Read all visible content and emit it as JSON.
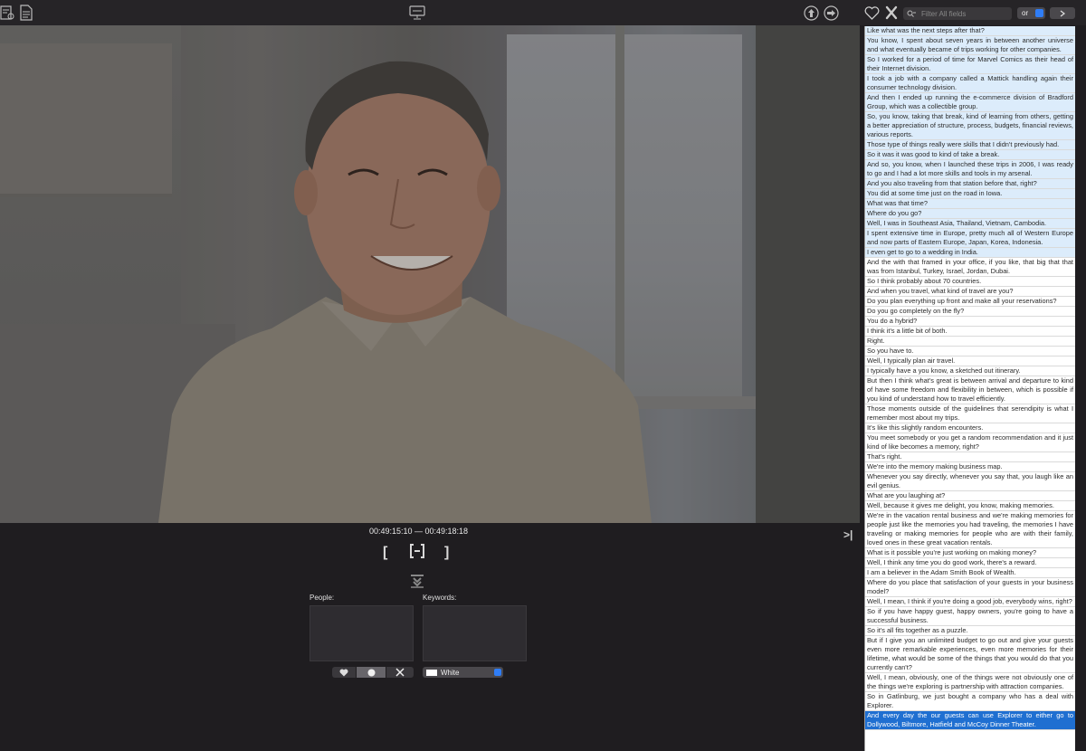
{
  "toolbar": {
    "filter_placeholder": "Filter All fields",
    "operator": "or"
  },
  "playback": {
    "timecode": "00:49:15:10 — 00:49:18:18",
    "mark_in": "[",
    "mark_out": "]"
  },
  "panels": {
    "people_label": "People:",
    "keywords_label": "Keywords:",
    "color_label": "White",
    "color_swatch": "#ffffff"
  },
  "transcript": {
    "highlighted_range": [
      0,
      15
    ],
    "selected_index": 47,
    "lines": [
      "Like what was the next steps after that?",
      "You know, I spent about seven years in between another universe and what eventually became of trips working for other companies.",
      "So I worked for a period of time for Marvel Comics as their head of their Internet division.",
      "I took a job with a company called a Mattick handling again their consumer technology division.",
      "And then I ended up running the e-commerce division of Bradford Group, which was a collectible group.",
      "So, you know, taking that break, kind of learning from others, getting a better appreciation of structure, process, budgets, financial reviews, various reports.",
      "Those type of things really were skills that I didn't previously had.",
      "So it was it was good to kind of take a break.",
      "And so, you know, when I launched these trips in 2006, I was ready to go and I had a lot more skills and tools in my arsenal.",
      "And you also traveling from that station before that, right?",
      "You did at some time just on the road in Iowa.",
      "What was that time?",
      "Where do you go?",
      "Well, I was in Southeast Asia, Thailand, Vietnam, Cambodia.",
      "I spent extensive time in Europe, pretty much all of Western Europe and now parts of Eastern Europe, Japan, Korea, Indonesia.",
      "I even get to go to a wedding in India.",
      "And the with that framed in your office, if you like, that big that that was from Istanbul, Turkey, Israel, Jordan, Dubai.",
      "So I think probably about 70 countries.",
      "And when you travel, what kind of travel are you?",
      "Do you plan everything up front and make all your reservations?",
      "Do you go completely on the fly?",
      "You do a hybrid?",
      "I think it's a little bit of both.",
      "Right.",
      "So you have to.",
      "Well, I typically plan air travel.",
      "I typically have a you know, a sketched out itinerary.",
      "But then I think what's great is between arrival and departure to kind of have some freedom and flexibility in between, which is possible if you kind of understand how to travel efficiently.",
      "Those moments outside of the guidelines that serendipity is what I remember most about my trips.",
      "It's like this slightly random encounters.",
      "You meet somebody or you get a random recommendation and it just kind of like becomes a memory, right?",
      "That's right.",
      "We're into the memory making business map.",
      "Whenever you say directly, whenever you say that, you laugh like an evil genius.",
      "What are you laughing at?",
      "Well, because it gives me delight, you know, making memories.",
      "We're in the vacation rental business and we're making memories for people just like the memories you had traveling, the memories I have traveling or making memories for people who are with their family, loved ones in these great vacation rentals.",
      "What is it possible you're just working on making money?",
      "Well, I think any time you do good work, there's a reward.",
      "I am a believer in the Adam Smith Book of Wealth.",
      "Where do you place that satisfaction of your guests in your business model?",
      "Well, I mean, I think if you're doing a good job, everybody wins, right?",
      "So if you have happy guest, happy owners, you're going to have a successful business.",
      "So it's all fits together as a puzzle.",
      "But if I give you an unlimited budget to go out and give your guests even more remarkable experiences, even more memories for their lifetime, what would be some of the things that you would do that you currently can't?",
      "Well, I mean, obviously, one of the things were not obviously one of the things we're exploring is partnership with attraction companies.",
      "So in Gatlinburg, we just bought a company who has a deal with Explorer.",
      "And every day the our guests can use Explorer to either go to Dollywood, Biltmore, Hatfield and McCoy Dinner Theater."
    ]
  }
}
